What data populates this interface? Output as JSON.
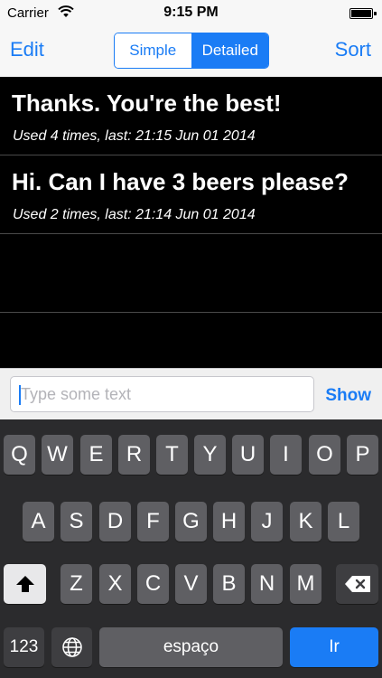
{
  "status_bar": {
    "carrier": "Carrier",
    "time": "9:15 PM"
  },
  "nav": {
    "left_button": "Edit",
    "right_button": "Sort",
    "segments": [
      {
        "label": "Simple",
        "selected": false
      },
      {
        "label": "Detailed",
        "selected": true
      }
    ]
  },
  "list": {
    "items": [
      {
        "title": "Thanks. You're the best!",
        "subtitle": "Used 4 times, last: 21:15 Jun 01 2014"
      },
      {
        "title": "Hi. Can I have 3 beers please?",
        "subtitle": "Used 2 times, last: 21:14 Jun 01 2014"
      }
    ]
  },
  "input": {
    "placeholder": "Type some text",
    "value": "",
    "action_label": "Show"
  },
  "keyboard": {
    "row1": [
      "Q",
      "W",
      "E",
      "R",
      "T",
      "Y",
      "U",
      "I",
      "O",
      "P"
    ],
    "row2": [
      "A",
      "S",
      "D",
      "F",
      "G",
      "H",
      "J",
      "K",
      "L"
    ],
    "row3": [
      "Z",
      "X",
      "C",
      "V",
      "B",
      "N",
      "M"
    ],
    "numbers_label": "123",
    "space_label": "espaço",
    "return_label": "Ir",
    "shift_icon": "shift-icon",
    "delete_icon": "backspace-icon",
    "globe_icon": "globe-icon"
  },
  "colors": {
    "accent": "#1a7cf5"
  }
}
